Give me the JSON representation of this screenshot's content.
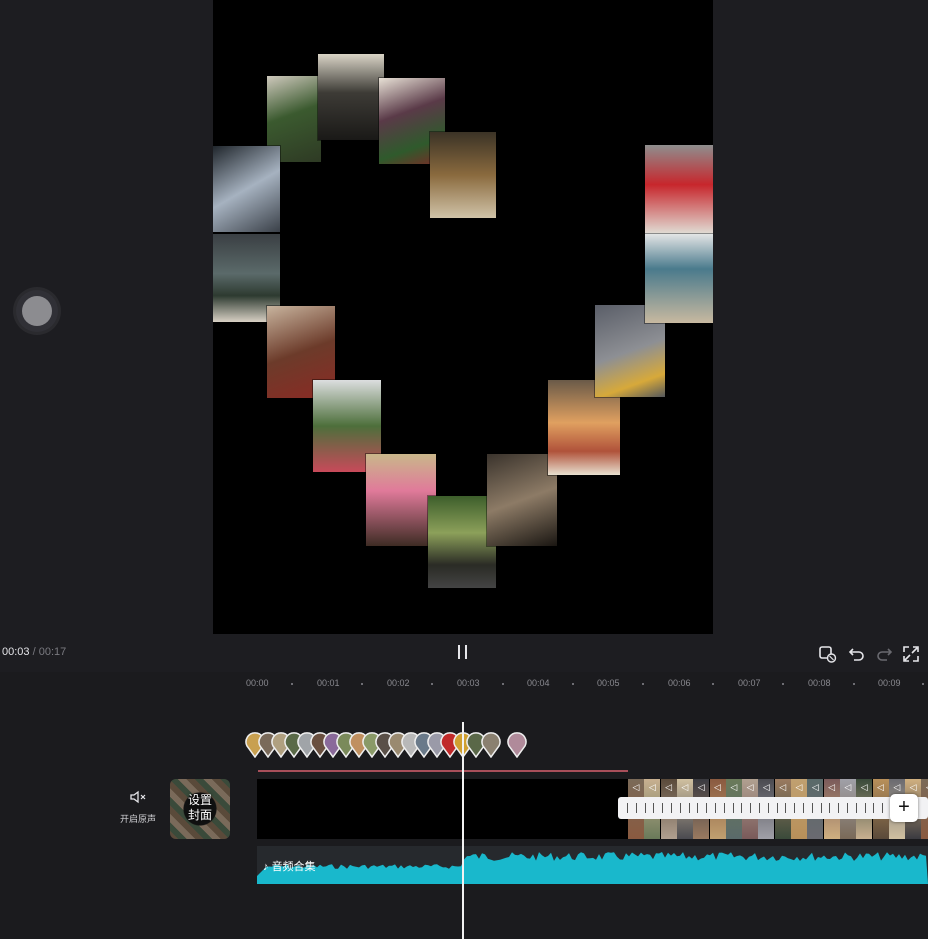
{
  "playback": {
    "current_time": "00:03",
    "separator": "/",
    "total_time": "00:17"
  },
  "toolbar": {
    "icons": [
      "keyframe-icon",
      "undo-icon",
      "redo-icon",
      "fullscreen-icon"
    ]
  },
  "ruler": {
    "ticks": [
      "00:00",
      "00:01",
      "00:02",
      "00:03",
      "00:04",
      "00:05",
      "00:06",
      "00:07",
      "00:08",
      "00:09"
    ]
  },
  "track_controls": {
    "mute_label": "开启原声",
    "cover_label": "设置\n封面"
  },
  "audio_track": {
    "title": "音频合集"
  },
  "colors": {
    "accent_waveform": "#19b8cc",
    "sticker_underline": "#a84f5a",
    "playhead": "#f2f2f2"
  }
}
